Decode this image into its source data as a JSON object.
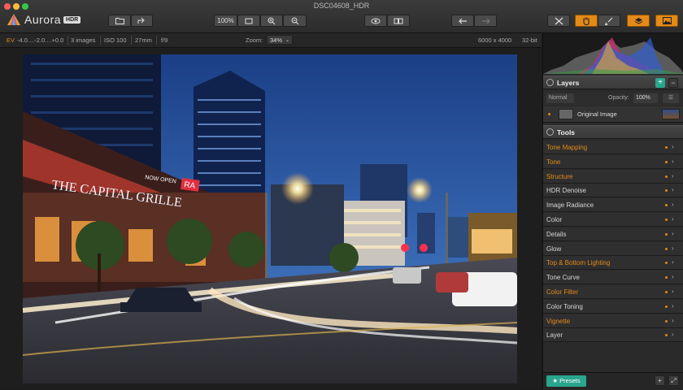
{
  "window": {
    "title": "DSC04608_HDR"
  },
  "app": {
    "name": "Aurora",
    "badge": "HDR"
  },
  "toolbar": {
    "zoom_fit_label": "100%",
    "open_icon": "folder-icon",
    "share_icon": "share-icon",
    "fit_icon": "fit-screen-icon",
    "zoom_in_icon": "zoom-in-icon",
    "zoom_out_icon": "zoom-out-icon",
    "preview_icon": "eye-icon",
    "compare_icon": "compare-icon",
    "undo_icon": "undo-icon",
    "redo_icon": "redo-icon",
    "crop_icon": "crop-icon",
    "hand_icon": "hand-icon",
    "brush_icon": "brush-icon",
    "layers_icon": "layers-icon",
    "image_icon": "image-icon"
  },
  "infobar": {
    "ev_label": "EV",
    "ev_values": "-4.0....-2.0....+0.0",
    "images": "3 images",
    "iso": "ISO 100",
    "focal": "27mm",
    "aperture": "f/9",
    "zoom_label": "Zoom:",
    "zoom_value": "34%",
    "dimensions": "6000 x 4000",
    "bit_depth": "32-bit"
  },
  "layers": {
    "title": "Layers",
    "blend_mode": "Normal",
    "opacity_label": "Opacity:",
    "opacity_value": "100%",
    "items": [
      {
        "name": "Original Image"
      }
    ]
  },
  "tools": {
    "title": "Tools",
    "items": [
      {
        "label": "Tone Mapping",
        "active": true
      },
      {
        "label": "Tone",
        "active": true
      },
      {
        "label": "Structure",
        "active": true
      },
      {
        "label": "HDR Denoise",
        "active": false
      },
      {
        "label": "Image Radiance",
        "active": false
      },
      {
        "label": "Color",
        "active": false
      },
      {
        "label": "Details",
        "active": false
      },
      {
        "label": "Glow",
        "active": false
      },
      {
        "label": "Top & Bottom Lighting",
        "active": true
      },
      {
        "label": "Tone Curve",
        "active": false
      },
      {
        "label": "Color Filter",
        "active": true
      },
      {
        "label": "Color Toning",
        "active": false
      },
      {
        "label": "Vignette",
        "active": true
      },
      {
        "label": "Layer",
        "active": false
      }
    ]
  },
  "footer": {
    "presets_label": "★ Presets"
  },
  "photo": {
    "signs": {
      "capital": "THE CAPITAL GRILLE",
      "now_open": "NOW OPEN",
      "ra": "RA"
    }
  },
  "colors": {
    "accent": "#e48a18",
    "presets": "#2aa58e",
    "active_tool": "#e48a18",
    "inactive_tool": "#d6d6d6"
  }
}
